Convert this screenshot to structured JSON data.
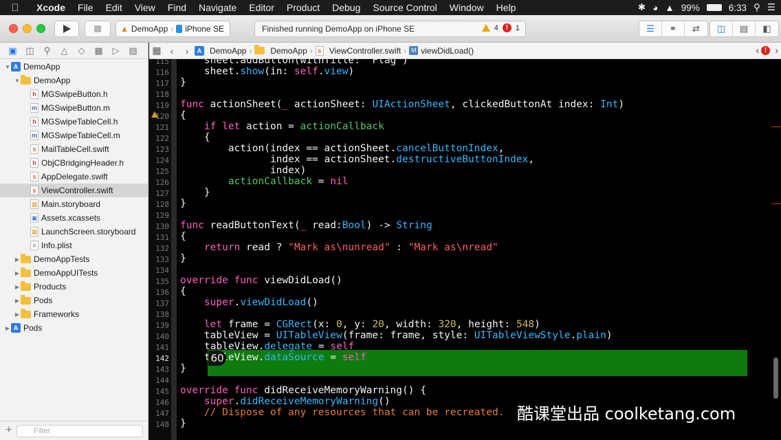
{
  "menubar": {
    "app": "Xcode",
    "items": [
      "File",
      "Edit",
      "View",
      "Find",
      "Navigate",
      "Editor",
      "Product",
      "Debug",
      "Source Control",
      "Window",
      "Help"
    ],
    "battery": "99%",
    "time": "6:33"
  },
  "toolbar": {
    "scheme": "DemoApp",
    "device": "iPhone SE",
    "status": "Finished running DemoApp on iPhone SE",
    "warnings": "4",
    "errors": "1"
  },
  "navigator": {
    "filter_placeholder": "Filter",
    "tree": [
      {
        "label": "DemoApp",
        "kind": "project",
        "depth": 0,
        "open": true
      },
      {
        "label": "DemoApp",
        "kind": "folder",
        "depth": 1,
        "open": true
      },
      {
        "label": "MGSwipeButton.h",
        "kind": "h",
        "depth": 2
      },
      {
        "label": "MGSwipeButton.m",
        "kind": "m",
        "depth": 2
      },
      {
        "label": "MGSwipeTableCell.h",
        "kind": "h",
        "depth": 2
      },
      {
        "label": "MGSwipeTableCell.m",
        "kind": "m",
        "depth": 2
      },
      {
        "label": "MailTableCell.swift",
        "kind": "swift",
        "depth": 2
      },
      {
        "label": "ObjCBridgingHeader.h",
        "kind": "h",
        "depth": 2
      },
      {
        "label": "AppDelegate.swift",
        "kind": "swift",
        "depth": 2
      },
      {
        "label": "ViewController.swift",
        "kind": "swift",
        "depth": 2,
        "selected": true
      },
      {
        "label": "Main.storyboard",
        "kind": "sb",
        "depth": 2
      },
      {
        "label": "Assets.xcassets",
        "kind": "assets",
        "depth": 2
      },
      {
        "label": "LaunchScreen.storyboard",
        "kind": "sb",
        "depth": 2
      },
      {
        "label": "Info.plist",
        "kind": "plist",
        "depth": 2
      },
      {
        "label": "DemoAppTests",
        "kind": "folder",
        "depth": 1
      },
      {
        "label": "DemoAppUITests",
        "kind": "folder",
        "depth": 1
      },
      {
        "label": "Products",
        "kind": "folder",
        "depth": 1
      },
      {
        "label": "Pods",
        "kind": "folder",
        "depth": 1
      },
      {
        "label": "Frameworks",
        "kind": "folder",
        "depth": 1
      },
      {
        "label": "Pods",
        "kind": "project",
        "depth": 0
      }
    ]
  },
  "jumpbar": {
    "crumbs": [
      "DemoApp",
      "DemoApp",
      "ViewController.swift",
      "viewDidLoad()"
    ]
  },
  "editor": {
    "current_line": 142,
    "highlight_badge": "60",
    "lines": [
      {
        "n": 115,
        "tokens": [
          [
            "    ",
            ""
          ],
          [
            "sheet.addButton(withTitle: \"Flag\")",
            ""
          ]
        ]
      },
      {
        "n": 116,
        "tokens": [
          [
            "    sheet.",
            ""
          ],
          [
            "show",
            "ty"
          ],
          [
            "(in: ",
            ""
          ],
          [
            "self",
            "kw"
          ],
          [
            ".",
            ""
          ],
          [
            "view",
            "ty"
          ],
          [
            ")",
            ""
          ]
        ]
      },
      {
        "n": 117,
        "tokens": [
          [
            "}",
            ""
          ]
        ]
      },
      {
        "n": 118,
        "tokens": []
      },
      {
        "n": 119,
        "tokens": [
          [
            "func",
            "kw"
          ],
          [
            " actionSheet(",
            ""
          ],
          [
            "_",
            "kw"
          ],
          [
            " actionSheet: ",
            ""
          ],
          [
            "UIActionSheet",
            "ty"
          ],
          [
            ", clickedButtonAt index: ",
            ""
          ],
          [
            "Int",
            "ty"
          ],
          [
            ")",
            ""
          ]
        ]
      },
      {
        "n": 120,
        "tokens": [
          [
            "{",
            ""
          ]
        ]
      },
      {
        "n": 121,
        "tokens": [
          [
            "    ",
            ""
          ],
          [
            "if",
            "kw"
          ],
          [
            " ",
            ""
          ],
          [
            "let",
            "kw"
          ],
          [
            " action = ",
            ""
          ],
          [
            "actionCallback",
            "fn"
          ]
        ]
      },
      {
        "n": 122,
        "tokens": [
          [
            "    {",
            ""
          ]
        ]
      },
      {
        "n": 123,
        "tokens": [
          [
            "        action(index == actionSheet.",
            ""
          ],
          [
            "cancelButtonIndex",
            "ty"
          ],
          [
            ",",
            ""
          ]
        ]
      },
      {
        "n": 124,
        "tokens": [
          [
            "               index == actionSheet.",
            ""
          ],
          [
            "destructiveButtonIndex",
            "ty"
          ],
          [
            ",",
            ""
          ]
        ]
      },
      {
        "n": 125,
        "tokens": [
          [
            "               index)",
            ""
          ]
        ]
      },
      {
        "n": 126,
        "tokens": [
          [
            "        ",
            ""
          ],
          [
            "actionCallback",
            "fn"
          ],
          [
            " = ",
            ""
          ],
          [
            "nil",
            "kw"
          ]
        ]
      },
      {
        "n": 127,
        "tokens": [
          [
            "    }",
            ""
          ]
        ]
      },
      {
        "n": 128,
        "tokens": [
          [
            "}",
            ""
          ]
        ]
      },
      {
        "n": 129,
        "tokens": []
      },
      {
        "n": 130,
        "tokens": [
          [
            "func",
            "kw"
          ],
          [
            " readButtonText(",
            ""
          ],
          [
            "_",
            "kw"
          ],
          [
            " read:",
            ""
          ],
          [
            "Bool",
            "ty"
          ],
          [
            ") -> ",
            ""
          ],
          [
            "String",
            "ty"
          ]
        ]
      },
      {
        "n": 131,
        "tokens": [
          [
            "{",
            ""
          ]
        ]
      },
      {
        "n": 132,
        "tokens": [
          [
            "    ",
            ""
          ],
          [
            "return",
            "kw"
          ],
          [
            " read ? ",
            ""
          ],
          [
            "\"Mark as\\nunread\"",
            "str"
          ],
          [
            " : ",
            ""
          ],
          [
            "\"Mark as\\nread\"",
            "str"
          ]
        ]
      },
      {
        "n": 133,
        "tokens": [
          [
            "}",
            ""
          ]
        ]
      },
      {
        "n": 134,
        "tokens": []
      },
      {
        "n": 135,
        "tokens": [
          [
            "override",
            "kw"
          ],
          [
            " ",
            ""
          ],
          [
            "func",
            "kw"
          ],
          [
            " viewDidLoad()",
            ""
          ]
        ]
      },
      {
        "n": 136,
        "tokens": [
          [
            "{",
            ""
          ]
        ]
      },
      {
        "n": 137,
        "tokens": [
          [
            "    ",
            ""
          ],
          [
            "super",
            "kw"
          ],
          [
            ".",
            ""
          ],
          [
            "viewDidLoad",
            "ty"
          ],
          [
            "()",
            ""
          ]
        ]
      },
      {
        "n": 138,
        "tokens": []
      },
      {
        "n": 139,
        "tokens": [
          [
            "    ",
            ""
          ],
          [
            "let",
            "kw"
          ],
          [
            " frame = ",
            ""
          ],
          [
            "CGRect",
            "ty"
          ],
          [
            "(x: ",
            ""
          ],
          [
            "0",
            "num"
          ],
          [
            ", y: ",
            ""
          ],
          [
            "20",
            "num"
          ],
          [
            ", width: ",
            ""
          ],
          [
            "320",
            "num"
          ],
          [
            ", height: ",
            ""
          ],
          [
            "548",
            "num"
          ],
          [
            ")",
            ""
          ]
        ]
      },
      {
        "n": 140,
        "tokens": [
          [
            "    tableView = ",
            ""
          ],
          [
            "UITableView",
            "ty"
          ],
          [
            "(frame: frame, style: ",
            ""
          ],
          [
            "UITableViewStyle",
            "ty"
          ],
          [
            ".",
            ""
          ],
          [
            "plain",
            "ty"
          ],
          [
            ")",
            ""
          ]
        ]
      },
      {
        "n": 141,
        "tokens": [
          [
            "    tableView.",
            ""
          ],
          [
            "delegate",
            "ty"
          ],
          [
            " = ",
            ""
          ],
          [
            "self",
            "kw"
          ]
        ]
      },
      {
        "n": 142,
        "tokens": [
          [
            "    tableView.",
            ""
          ],
          [
            "dataSource",
            "ty"
          ],
          [
            " = ",
            ""
          ],
          [
            "self",
            "kw"
          ]
        ]
      },
      {
        "n": 143,
        "tokens": [
          [
            "}",
            ""
          ]
        ]
      },
      {
        "n": 144,
        "tokens": []
      },
      {
        "n": 145,
        "tokens": [
          [
            "override",
            "kw"
          ],
          [
            " ",
            ""
          ],
          [
            "func",
            "kw"
          ],
          [
            " didReceiveMemoryWarning() {",
            ""
          ]
        ]
      },
      {
        "n": 146,
        "tokens": [
          [
            "    ",
            ""
          ],
          [
            "super",
            "kw"
          ],
          [
            ".",
            ""
          ],
          [
            "didReceiveMemoryWarning",
            "ty"
          ],
          [
            "()",
            ""
          ]
        ]
      },
      {
        "n": 147,
        "tokens": [
          [
            "    ",
            ""
          ],
          [
            "// Dispose of any resources that can be recreated.",
            "cm"
          ]
        ]
      },
      {
        "n": 148,
        "tokens": [
          [
            "}",
            ""
          ]
        ]
      }
    ]
  },
  "watermark": "酷课堂出品 coolketang.com",
  "colors": {
    "keyword": "#ff5ec0",
    "type": "#34b6ff",
    "function": "#56c95f",
    "string": "#ff5f5f",
    "number": "#c9bd5a",
    "comment": "#e87b2f",
    "highlight": "#0e7b0e"
  }
}
